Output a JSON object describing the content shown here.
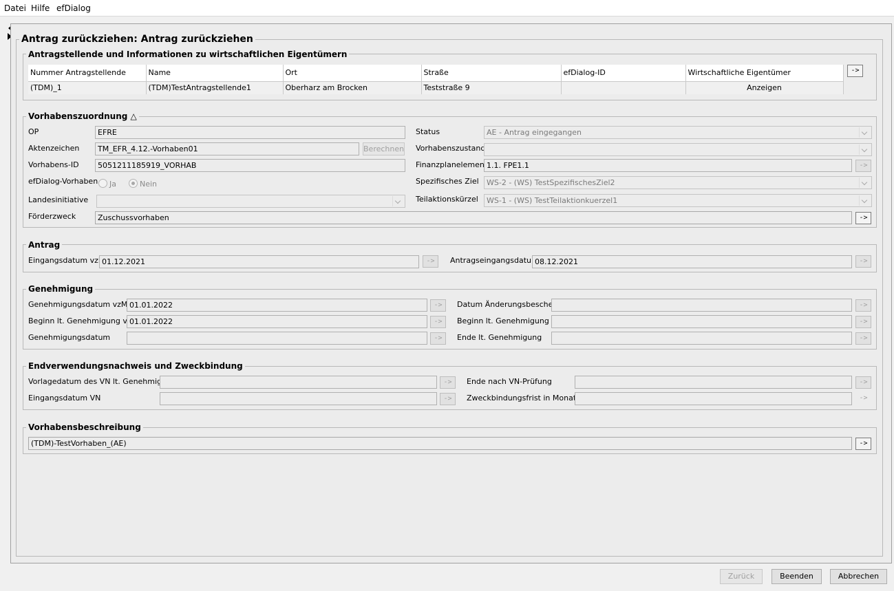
{
  "menu": {
    "datei": "Datei",
    "hilfe": "Hilfe",
    "efdialog": "efDialog"
  },
  "page_title": "Antrag zurückziehen: Antrag zurückziehen",
  "applicants": {
    "legend": "Antragstellende und Informationen zu wirtschaftlichen Eigentümern",
    "columns": [
      "Nummer Antragstellende",
      "Name",
      "Ort",
      "Straße",
      "efDialog-ID",
      "Wirtschaftliche Eigentümer"
    ],
    "rows": [
      {
        "nummer": "(TDM)_1",
        "name": "(TDM)TestAntragstellende1",
        "ort": "Oberharz am Brocken",
        "strasse": "Teststraße 9",
        "efdialog_id": "",
        "eigentuemer": "Anzeigen"
      }
    ],
    "arrow": "->"
  },
  "vorhaben": {
    "legend": "Vorhabenszuordnung",
    "legend_icon": "△",
    "op_label": "OP",
    "op_value": "EFRE",
    "akten_label": "Aktenzeichen",
    "akten_value": "TM_EFR_4.12.-Vorhaben01",
    "berechnen": "Berechnen",
    "vid_label": "Vorhabens-ID",
    "vid_value": "5051211185919_VORHAB",
    "efd_label": "efDialog-Vorhaben",
    "radio_ja": "Ja",
    "radio_nein": "Nein",
    "landes_label": "Landesinitiative",
    "landes_value": "",
    "zweck_label": "Förderzweck",
    "zweck_value": "Zuschussvorhaben",
    "status_label": "Status",
    "status_value": "AE - Antrag eingegangen",
    "zustand_label": "Vorhabenszustand",
    "zustand_value": "",
    "finanz_label": "Finanzplanelement",
    "finanz_value": "1.1. FPE1.1",
    "ziel_label": "Spezifisches Ziel",
    "ziel_value": "WS-2 - (WS) TestSpezifischesZiel2",
    "teil_label": "Teilaktionskürzel",
    "teil_value": "WS-1 - (WS) TestTeilaktionkuerzel1"
  },
  "antrag": {
    "legend": "Antrag",
    "eingang_label": "Eingangsdatum vzM",
    "eingang_value": "01.12.2021",
    "antragseingang_label": "Antragseingangsdatum",
    "antragseingang_value": "08.12.2021"
  },
  "genehmigung": {
    "legend": "Genehmigung",
    "gdat_vzm_label": "Genehmigungsdatum vzM",
    "gdat_vzm_value": "01.01.2022",
    "beginn_vzm_label": "Beginn lt. Genehmigung vzM",
    "beginn_vzm_value": "01.01.2022",
    "gdat_label": "Genehmigungsdatum",
    "gdat_value": "",
    "aend_label": "Datum Änderungsbescheid",
    "aend_value": "",
    "beginn_label": "Beginn lt. Genehmigung",
    "beginn_value": "",
    "ende_label": "Ende lt. Genehmigung",
    "ende_value": ""
  },
  "endverwendung": {
    "legend": "Endverwendungsnachweis und Zweckbindung",
    "vorlage_label": "Vorlagedatum des VN lt. Genehmigung",
    "vorlage_value": "",
    "eingang_vn_label": "Eingangsdatum VN",
    "eingang_vn_value": "",
    "ende_vn_label": "Ende nach VN-Prüfung",
    "ende_vn_value": "",
    "frist_label": "Zweckbindungsfrist in Monaten",
    "frist_value": ""
  },
  "beschreibung": {
    "legend": "Vorhabensbeschreibung",
    "value": "(TDM)-TestVorhaben_(AE)"
  },
  "buttons": {
    "arrow": "->",
    "zurueck": "Zurück",
    "beenden": "Beenden",
    "abbrechen": "Abbrechen"
  }
}
